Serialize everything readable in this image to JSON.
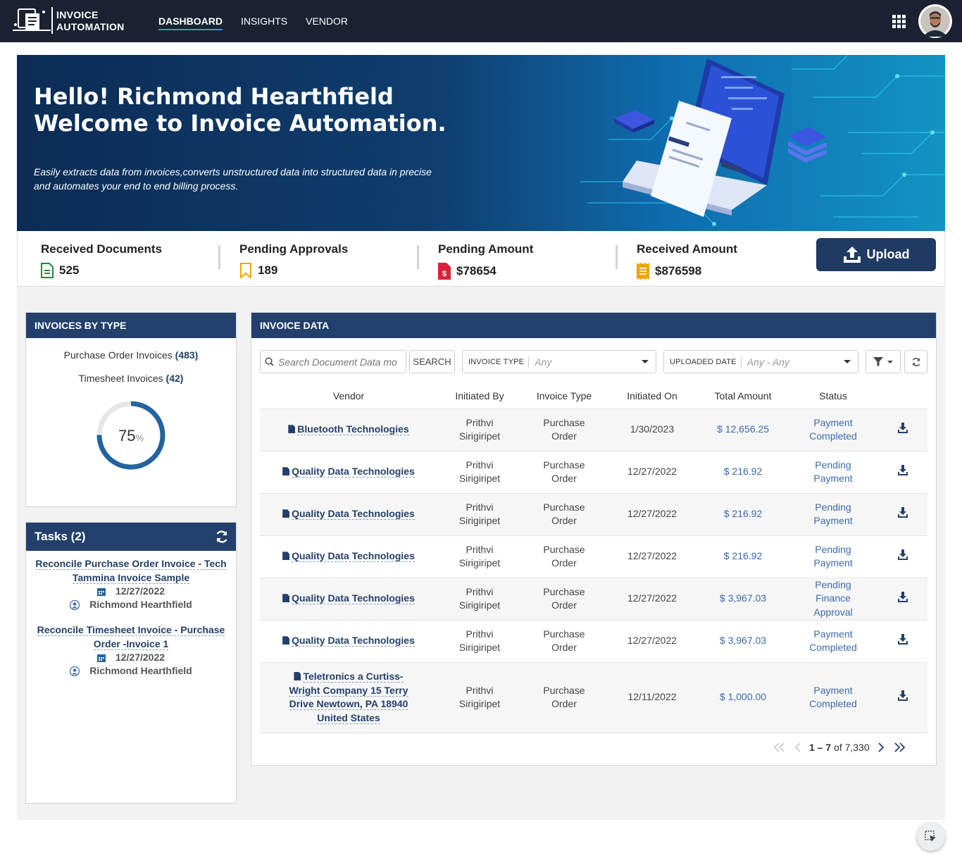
{
  "header": {
    "logo_line1": "INVOICE",
    "logo_line2": "AUTOMATION",
    "nav": [
      "DASHBOARD",
      "INSIGHTS",
      "VENDOR"
    ],
    "active_nav": "DASHBOARD"
  },
  "banner": {
    "greeting": "Hello! Richmond Hearthfield",
    "welcome": "Welcome to Invoice Automation.",
    "description": "Easily extracts data from invoices,converts unstructured data into structured data in precise and automates your end to end billing process."
  },
  "stats": {
    "received_documents": {
      "label": "Received Documents",
      "value": "525"
    },
    "pending_approvals": {
      "label": "Pending Approvals",
      "value": "189"
    },
    "pending_amount": {
      "label": "Pending Amount",
      "value": "$78654"
    },
    "received_amount": {
      "label": "Received Amount",
      "value": "$876598"
    },
    "upload_label": "Upload"
  },
  "invoices_by_type": {
    "title": "INVOICES BY TYPE",
    "po_label": "Purchase Order Invoices",
    "po_count": "(483)",
    "ts_label": "Timesheet Invoices",
    "ts_count": "(42)",
    "percent": "75",
    "percent_unit": "%",
    "fraction": 0.75
  },
  "tasks": {
    "title": "Tasks (2)",
    "items": [
      {
        "title": "Reconcile Purchase Order Invoice - Tech Tammina Invoice Sample",
        "date": "12/27/2022",
        "user": "Richmond Hearthfield"
      },
      {
        "title": "Reconcile Timesheet Invoice - Purchase Order -Invoice 1",
        "date": "12/27/2022",
        "user": "Richmond Hearthfield"
      }
    ]
  },
  "invoice_data": {
    "title": "INVOICE DATA",
    "search_placeholder": "Search Document Data mo",
    "search_button": "SEARCH",
    "invoice_type_label": "INVOICE TYPE",
    "invoice_type_value": "Any",
    "uploaded_date_label": "UPLOADED DATE",
    "uploaded_date_value": "Any - Any",
    "columns": [
      "Vendor",
      "Initiated By",
      "Invoice Type",
      "Initiated On",
      "Total Amount",
      "Status"
    ],
    "rows": [
      {
        "vendor": "Bluetooth Technologies",
        "initiated_by": "Prithvi Sirigiripet",
        "type": "Purchase Order",
        "initiated_on": "1/30/2023",
        "amount": "$ 12,656.25",
        "status": "Payment Completed"
      },
      {
        "vendor": "Quality Data Technologies",
        "initiated_by": "Prithvi Sirigiripet",
        "type": "Purchase Order",
        "initiated_on": "12/27/2022",
        "amount": "$ 216.92",
        "status": "Pending Payment"
      },
      {
        "vendor": "Quality Data Technologies",
        "initiated_by": "Prithvi Sirigiripet",
        "type": "Purchase Order",
        "initiated_on": "12/27/2022",
        "amount": "$ 216.92",
        "status": "Pending Payment"
      },
      {
        "vendor": "Quality Data Technologies",
        "initiated_by": "Prithvi Sirigiripet",
        "type": "Purchase Order",
        "initiated_on": "12/27/2022",
        "amount": "$ 216.92",
        "status": "Pending Payment"
      },
      {
        "vendor": "Quality Data Technologies",
        "initiated_by": "Prithvi Sirigiripet",
        "type": "Purchase Order",
        "initiated_on": "12/27/2022",
        "amount": "$ 3,967.03",
        "status": "Pending Finance Approval"
      },
      {
        "vendor": "Quality Data Technologies",
        "initiated_by": "Prithvi Sirigiripet",
        "type": "Purchase Order",
        "initiated_on": "12/27/2022",
        "amount": "$ 3,967.03",
        "status": "Payment Completed"
      },
      {
        "vendor": "Teletronics a Curtiss-Wright Company 15 Terry Drive Newtown, PA 18940 United States",
        "initiated_by": "Prithvi Sirigiripet",
        "type": "Purchase Order",
        "initiated_on": "12/11/2022",
        "amount": "$ 1,000.00",
        "status": "Payment Completed"
      }
    ],
    "pagination": {
      "range": "1 – 7",
      "of_label": "of 7,330"
    }
  },
  "colors": {
    "navbar": "#1b2130",
    "panel_header": "#23406c",
    "accent_link": "#3a6ab0",
    "donut": "#23649f"
  }
}
